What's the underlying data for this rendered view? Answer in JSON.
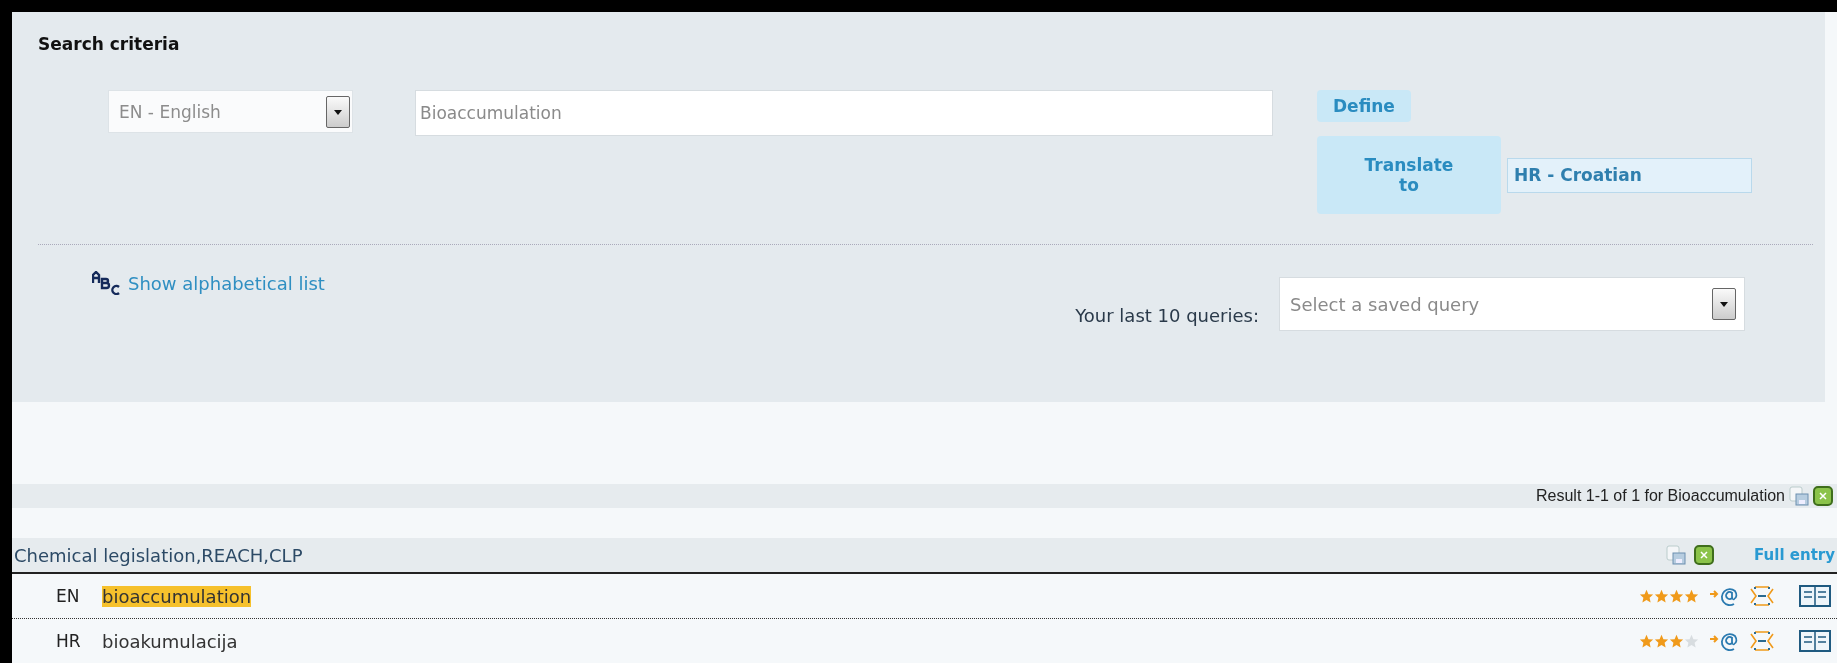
{
  "search_criteria": {
    "title": "Search criteria",
    "language_select": {
      "value": "EN - English"
    },
    "query_field": {
      "value": "Bioaccumulation"
    },
    "define_button": "Define",
    "translate_button": "Translate to",
    "target_language": {
      "value": "HR - Croatian"
    },
    "alphabetical_link": "Show alphabetical list",
    "last_queries": {
      "label": "Your last 10 queries:",
      "placeholder": "Select a saved query"
    }
  },
  "result_summary": "Result 1-1 of 1 for Bioaccumulation",
  "domain": {
    "title": "Chemical legislation,REACH,CLP",
    "full_entry_link": "Full entry"
  },
  "rows": [
    {
      "lang": "EN",
      "term": "bioaccumulation",
      "highlighted": true,
      "stars": 4
    },
    {
      "lang": "HR",
      "term": "bioakumulacija",
      "highlighted": false,
      "stars": 3
    }
  ]
}
